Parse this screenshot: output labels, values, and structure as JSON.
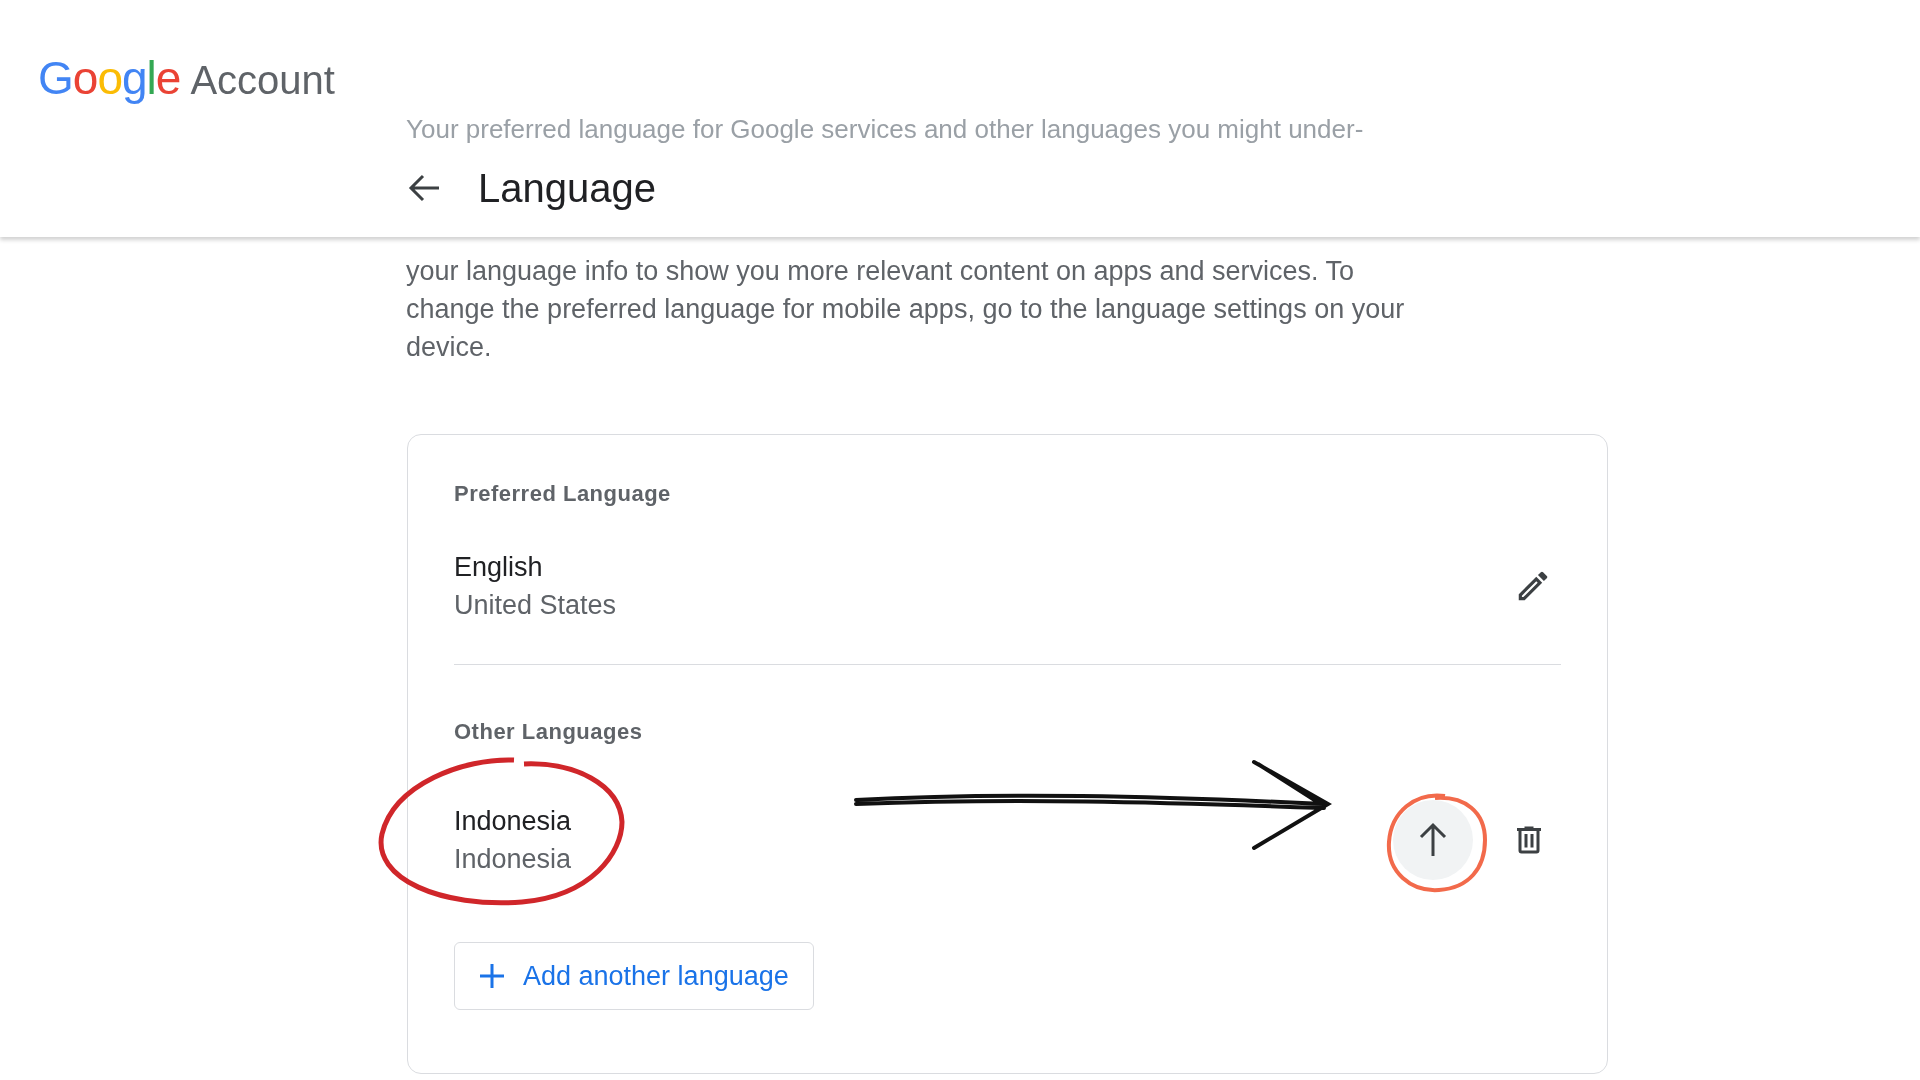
{
  "header": {
    "logo": "Google",
    "product": "Account",
    "faded_intro": "Your preferred language for Google services and other languages you might under-",
    "title": "Language"
  },
  "description": "your language info to show you more relevant content on apps and services. To change the preferred language for mobile apps, go to the language settings on your device.",
  "preferred": {
    "heading": "Preferred Language",
    "language": "English",
    "region": "United States"
  },
  "other": {
    "heading": "Other Languages",
    "languages": [
      {
        "language": "Indonesia",
        "region": "Indonesia",
        "highlighted": true
      }
    ]
  },
  "add_button": "Add another language"
}
